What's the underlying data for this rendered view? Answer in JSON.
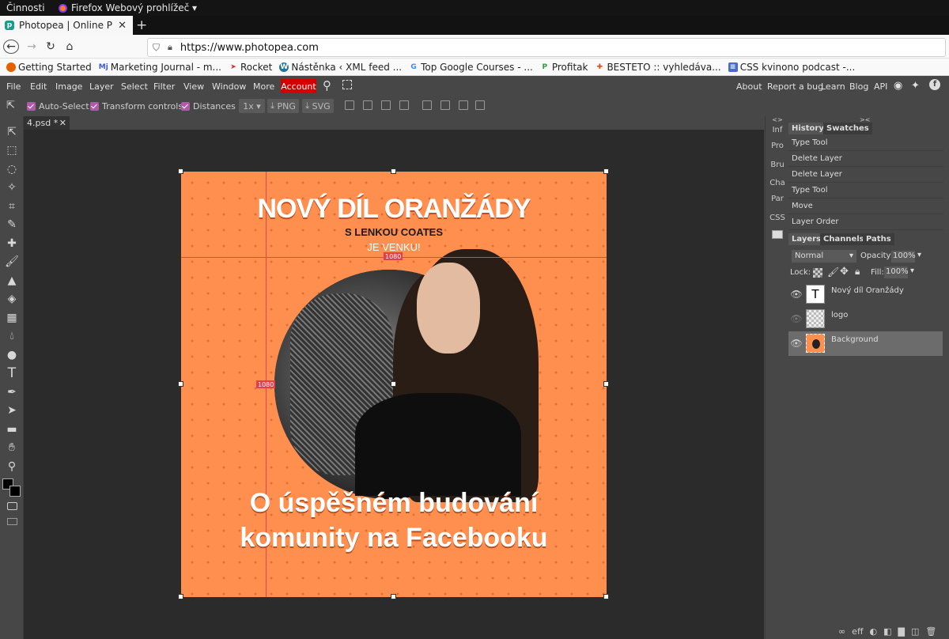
{
  "gnome": {
    "activities": "Činnosti",
    "app_menu": "Firefox Webový prohlížeč ▾"
  },
  "browser": {
    "tab_title": "Photopea | Online Photo",
    "url": "https://www.photopea.com",
    "bookmarks": [
      {
        "label": "Getting Started",
        "icon": "firefox-icon",
        "color": "#e66000"
      },
      {
        "label": "Marketing Journal - m...",
        "icon": "mj-icon",
        "color": "#3b5bdb"
      },
      {
        "label": "Rocket",
        "icon": "rocket-icon",
        "color": "#d03030"
      },
      {
        "label": "Nástěnka ‹ XML feed ...",
        "icon": "wordpress-icon",
        "color": "#21759b"
      },
      {
        "label": "Top Google Courses - ...",
        "icon": "google-icon",
        "color": "#4285f4"
      },
      {
        "label": "Profitak",
        "icon": "profitak-icon",
        "color": "#2e9e44"
      },
      {
        "label": "BESTETO :: vyhledáva...",
        "icon": "besteto-icon",
        "color": "#e04a1c"
      },
      {
        "label": "CSS kvinono podcast -...",
        "icon": "docs-icon",
        "color": "#4a69d4"
      }
    ]
  },
  "menu": {
    "items": [
      "File",
      "Edit",
      "Image",
      "Layer",
      "Select",
      "Filter",
      "View",
      "Window",
      "More"
    ],
    "account": "Account",
    "right": [
      "About",
      "Report a bug",
      "Learn",
      "Blog",
      "API"
    ]
  },
  "options": {
    "auto_select": "Auto-Select",
    "transform_controls": "Transform controls",
    "distances": "Distances",
    "zoom": "1x ▾",
    "png": "PNG",
    "svg": "SVG"
  },
  "document": {
    "tab": "4.psd *"
  },
  "artwork": {
    "title": "NOVÝ DÍL ORANŽÁDY",
    "subtitle": "S LENKOU COATES",
    "subtitle2": "JE VENKU!",
    "bottom1": "O úspěšném budování",
    "bottom2": "komunity na Facebooku",
    "dim_h": "1080",
    "dim_v": "1080",
    "bg_color": "#fe8f4f"
  },
  "mini_panel": [
    "Inf",
    "Pro",
    "Bru",
    "Cha",
    "Par",
    "CSS"
  ],
  "history": {
    "tabs": [
      "History",
      "Swatches"
    ],
    "items": [
      "Type Tool",
      "Delete Layer",
      "Delete Layer",
      "Type Tool",
      "Move",
      "Layer Order"
    ]
  },
  "layers": {
    "tabs": [
      "Layers",
      "Channels",
      "Paths"
    ],
    "blend": "Normal",
    "opacity_label": "Opacity:",
    "opacity": "100%",
    "lock_label": "Lock:",
    "fill_label": "Fill:",
    "fill": "100%",
    "items": [
      {
        "name": "Nový díl Oranžády",
        "thumb": "T"
      },
      {
        "name": "logo",
        "thumb": ""
      },
      {
        "name": "Background",
        "thumb": ""
      }
    ],
    "footer": "eff"
  }
}
